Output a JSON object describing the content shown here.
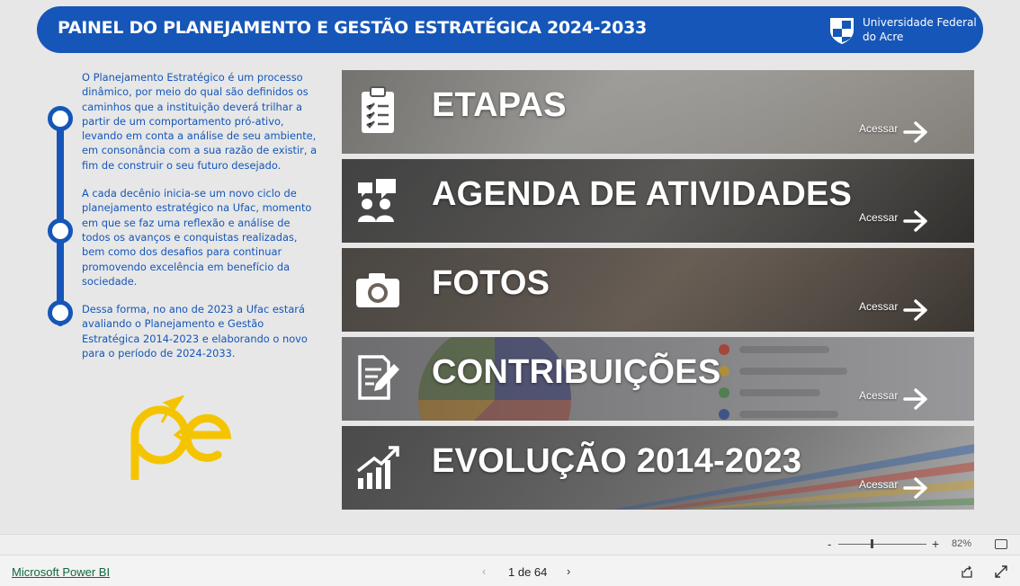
{
  "header": {
    "title": "PAINEL DO PLANEJAMENTO E GESTÃO ESTRATÉGICA 2024-2033",
    "university_line1": "Universidade Federal",
    "university_line2": "do Acre"
  },
  "intro": {
    "p1": "O Planejamento Estratégico é um processo dinâmico, por meio do qual são definidos os caminhos que a instituição deverá trilhar a partir de um comportamento pró-ativo, levando em conta a análise de seu ambiente, em consonância com a sua razão de existir, a fim de construir o seu futuro desejado.",
    "p2": "A cada decênio inicia-se um novo ciclo de planejamento estratégico na Ufac, momento em que se faz uma reflexão e análise de todos os avanços e conquistas realizadas, bem como dos desafios para continuar promovendo excelência em benefício da sociedade.",
    "p3": "Dessa forma, no ano de 2023 a Ufac estará avaliando o Planejamento e Gestão Estratégica 2014-2023 e elaborando o novo para o período de 2024-2033."
  },
  "cards": [
    {
      "label": "ETAPAS",
      "action": "Acessar",
      "icon": "clipboard-checklist-icon"
    },
    {
      "label": "AGENDA DE ATIVIDADES",
      "action": "Acessar",
      "icon": "people-chat-icon"
    },
    {
      "label": "FOTOS",
      "action": "Acessar",
      "icon": "camera-icon"
    },
    {
      "label": "CONTRIBUIÇÕES",
      "action": "Acessar",
      "icon": "document-edit-icon"
    },
    {
      "label": "EVOLUÇÃO 2014-2023",
      "action": "Acessar",
      "icon": "growth-chart-icon"
    }
  ],
  "zoom": {
    "minus": "-",
    "plus": "+",
    "level": "82%"
  },
  "footer": {
    "brand": "Microsoft Power BI",
    "page_indicator": "1 de 64"
  },
  "colors": {
    "primary": "#1556b8",
    "logo_yellow": "#f5c400",
    "pbi_link": "#11673d"
  }
}
